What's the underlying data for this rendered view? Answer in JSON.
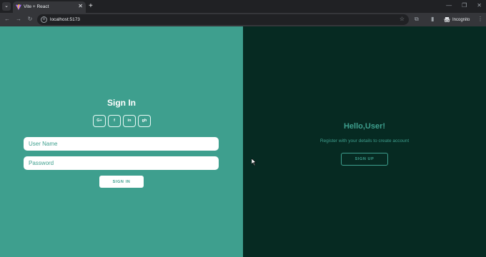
{
  "browser": {
    "tab_title": "Vite + React",
    "tab_close": "✕",
    "new_tab": "+",
    "url": "localhost:5173",
    "incognito_label": "Incognito",
    "icons": [
      "tab-search-icon",
      "vite-favicon-icon",
      "close-icon",
      "new-tab-icon",
      "minimize-icon",
      "restore-icon",
      "window-close-icon",
      "back-icon",
      "forward-icon",
      "reload-icon",
      "site-info-icon",
      "bookmark-star-icon",
      "extensions-icon",
      "side-panel-icon",
      "incognito-icon",
      "kebab-menu-icon"
    ]
  },
  "signin": {
    "title": "Sign In",
    "socials": [
      "G+",
      "f",
      "in",
      "gh"
    ],
    "username_placeholder": "User Name",
    "password_placeholder": "Password",
    "button_label": "SIGN IN"
  },
  "signup_panel": {
    "heading": "Hello,User!",
    "text": "Register with your details to create account",
    "button_label": "SIGN UP"
  },
  "colors": {
    "left_panel": "#3e9f8e",
    "right_panel": "#062a22",
    "accent": "#3e9f8e"
  }
}
